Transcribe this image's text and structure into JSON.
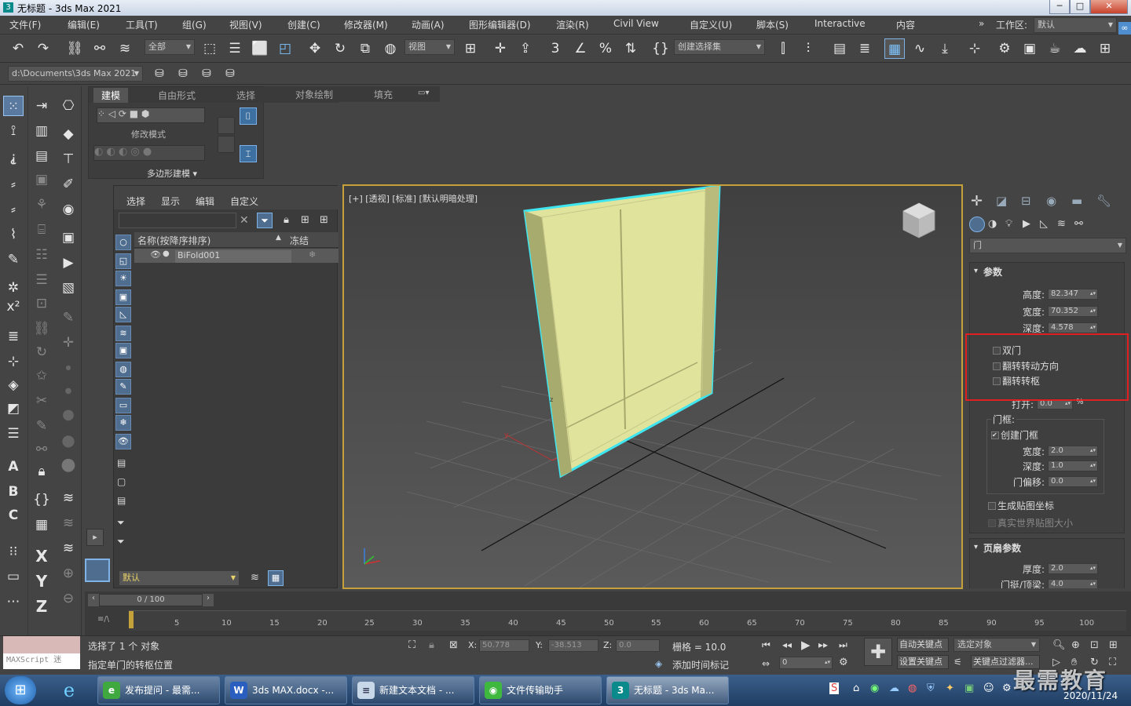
{
  "window": {
    "title": "无标题 - 3ds Max 2021",
    "icon": "3",
    "minimize": "─",
    "maximize": "□",
    "close": "✕"
  },
  "menu": [
    "文件(F)",
    "编辑(E)",
    "工具(T)",
    "组(G)",
    "视图(V)",
    "创建(C)",
    "修改器(M)",
    "动画(A)",
    "图形编辑器(D)",
    "渲染(R)",
    "Civil View",
    "自定义(U)",
    "脚本(S)",
    "Interactive",
    "内容"
  ],
  "workspace": {
    "label": "工作区:",
    "value": "默认",
    "more": "»"
  },
  "toolbar": {
    "filter_dropdown": "全部",
    "refcoord_dropdown": "视图",
    "selection_set": "创建选择集",
    "snap_value": "3"
  },
  "project_path": "d:\\Documents\\3ds Max 2021",
  "ribbon": {
    "tabs": [
      "建模",
      "自由形式",
      "选择",
      "对象绘制",
      "填充"
    ],
    "active_tab": "建模",
    "modify_mode": "修改模式",
    "poly_modeling": "多边形建模 ▾"
  },
  "scene_explorer": {
    "menus": [
      "选择",
      "显示",
      "编辑",
      "自定义"
    ],
    "col_name": "名称(按降序排序)",
    "col_freeze": "冻结",
    "sort_indicator": "▲",
    "object": "BiFold001",
    "layer_dropdown": "默认",
    "clear": "✕",
    "collapse": "▸"
  },
  "viewport": {
    "label": "[+] [透视] [标准] [默认明暗处理]",
    "axis_x": "x",
    "axis_y": "y",
    "axis_z": "z"
  },
  "command_panel": {
    "category_dropdown": "门",
    "rollout_params": "参数",
    "height_label": "高度:",
    "height_value": "82.347",
    "width_label": "宽度:",
    "width_value": "70.352",
    "depth_label": "深度:",
    "depth_value": "4.578",
    "double_door": "双门",
    "flip_swing": "翻转转动方向",
    "flip_hinge": "翻转转枢",
    "open_label": "打开:",
    "open_value": "0.0",
    "open_unit": "%",
    "frame_group": "门框:",
    "create_frame": "创建门框",
    "frame_width_label": "宽度:",
    "frame_width_value": "2.0",
    "frame_depth_label": "深度:",
    "frame_depth_value": "1.0",
    "frame_offset_label": "门偏移:",
    "frame_offset_value": "0.0",
    "gen_mapping": "生成贴图坐标",
    "real_world": "真实世界贴图大小",
    "rollout_leaf": "页扇参数",
    "thickness_label": "厚度:",
    "thickness_value": "2.0",
    "stile_label": "门挺/顶梁:",
    "stile_value": "4.0"
  },
  "timeline": {
    "frame_counter": "0 / 100",
    "ticks": [
      "5",
      "10",
      "15",
      "20",
      "25",
      "30",
      "35",
      "40",
      "45",
      "50",
      "55",
      "60",
      "65",
      "70",
      "75",
      "80",
      "85",
      "90",
      "95",
      "100"
    ]
  },
  "status": {
    "maxscript": "MAXScript 迷",
    "selected": "选择了 1 个 对象",
    "hint": "指定单门的转枢位置",
    "x_label": "X:",
    "x_value": "50.778",
    "y_label": "Y:",
    "y_value": "-38.513",
    "z_label": "Z:",
    "z_value": "0.0",
    "grid": "栅格 = 10.0",
    "add_time_tag": "添加时间标记",
    "auto_key": "自动关键点",
    "set_key": "设置关键点",
    "selected_obj": "选定对象",
    "key_filter": "关键点过滤器...",
    "frame_field": "0"
  },
  "taskbar": {
    "apps": [
      {
        "label": "发布提问 - 最需...",
        "icon": "e"
      },
      {
        "label": "3ds MAX.docx -...",
        "icon": "W"
      },
      {
        "label": "新建文本文档 - ...",
        "icon": "≡"
      },
      {
        "label": "文件传输助手",
        "icon": "◉"
      },
      {
        "label": "无标题 - 3ds Ma...",
        "icon": "3"
      }
    ],
    "clock_date": "2020/11/24",
    "watermark": "最需教育"
  },
  "colors": {
    "accent_blue": "#4f8fd0",
    "door": "#c8cc8a",
    "highlight_cyan": "#3fe6f0",
    "red_box": "#e02020",
    "viewport_border": "#c5a13a"
  }
}
